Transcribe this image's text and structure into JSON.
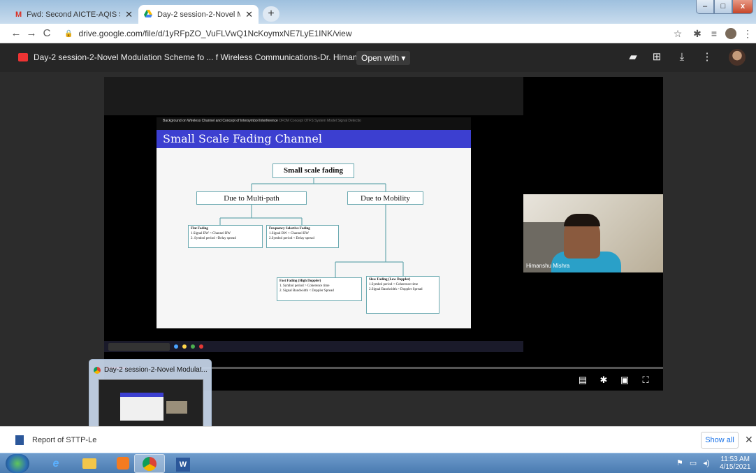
{
  "browser": {
    "tabs": [
      {
        "title": "Fwd: Second AICTE-AQIS Sponso",
        "icon": "gmail-icon",
        "active": false
      },
      {
        "title": "Day-2 session-2-Novel Modulati",
        "icon": "google-drive-icon",
        "active": true
      }
    ],
    "new_tab": "+",
    "url": "drive.google.com/file/d/1yRFpZO_VuFLVwQ1NcKoymxNE7LyE1INK/view",
    "window_controls": {
      "min": "–",
      "max": "□",
      "close": "x"
    }
  },
  "viewer": {
    "file_name": "Day-2 session-2-Novel Modulation Scheme fo ... f Wireless Communications-Dr. Himanshu.mp4",
    "open_with": "Open with ▾",
    "header_icons": [
      "add-to-drive-icon",
      "add-shortcut-icon",
      "download-icon",
      "more-icon"
    ]
  },
  "slide": {
    "nav_text": "Background on Wireless Channel and Concept of Intersymbol Interference",
    "nav_dim": "OFDM Concept   OTFS System Model   Signal Detectio",
    "title": "Small Scale Fading Channel",
    "root": "Small scale fading",
    "multipath": "Due to Multi-path",
    "mobility": "Due to Mobility",
    "flat": {
      "title": "Flat Fading",
      "l1": "1.Signal BW < Channel BW",
      "l2": "2. Symbol period >Delay spread"
    },
    "freq": {
      "title": "Frequency Selective Fading",
      "l1": "1.Signal BW > Channel BW",
      "l2": "2.Symbol period < Delay spread"
    },
    "fast": {
      "title": "Fast Fading (High Doppler)",
      "l1": "1. Symbol period > Coherence time",
      "l2": "2. Signal Bandwidth < Doppler Spread"
    },
    "slow": {
      "title": "Slow Fading (Low Doppler)",
      "l1": "1.Symbol period < Coherence time",
      "l2": "2.Signal Bandwidth > Doppler Spread"
    }
  },
  "webcam": {
    "name": "Himanshu Mishra"
  },
  "playback": {
    "progress": 0.04
  },
  "thumbnail": {
    "title": "Day-2 session-2-Novel Modulat..."
  },
  "downloads": {
    "item": "Report of STTP-Le",
    "show_all": "Show all",
    "close": "✕"
  },
  "taskbar": {
    "time": "11:53 AM",
    "date": "4/15/2021"
  }
}
